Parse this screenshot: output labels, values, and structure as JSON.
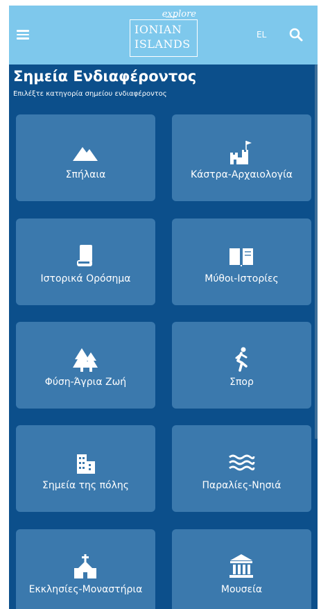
{
  "header": {
    "menu_icon": "hamburger-menu-icon",
    "logo": {
      "script": "explore",
      "line1": "IONIAN",
      "line2": "ISLANDS"
    },
    "language": "EL",
    "search_icon": "search-icon"
  },
  "page": {
    "title": "Σημεία Ενδιαφέροντος",
    "subtitle": "Επιλέξτε κατηγορία σημείου ενδιαφέροντος"
  },
  "categories": [
    {
      "label": "Σπήλαια",
      "icon": "mountain-icon"
    },
    {
      "label": "Κάστρα-Αρχαιολογία",
      "icon": "castle-icon"
    },
    {
      "label": "Ιστορικά Ορόσημα",
      "icon": "scroll-icon"
    },
    {
      "label": "Μύθοι-Ιστορίες",
      "icon": "book-icon"
    },
    {
      "label": "Φύση-Άγρια Ζωή",
      "icon": "trees-icon"
    },
    {
      "label": "Σπορ",
      "icon": "running-icon"
    },
    {
      "label": "Σημεία της πόλης",
      "icon": "building-icon"
    },
    {
      "label": "Παραλίες-Νησιά",
      "icon": "waves-icon"
    },
    {
      "label": "Εκκλησίες-Μοναστήρια",
      "icon": "church-icon"
    },
    {
      "label": "Μουσεία",
      "icon": "museum-icon"
    }
  ],
  "colors": {
    "header_bg": "#7ec8ec",
    "page_bg": "#0c4f8b",
    "card_bg": "#3b79ad",
    "text": "#ffffff"
  }
}
